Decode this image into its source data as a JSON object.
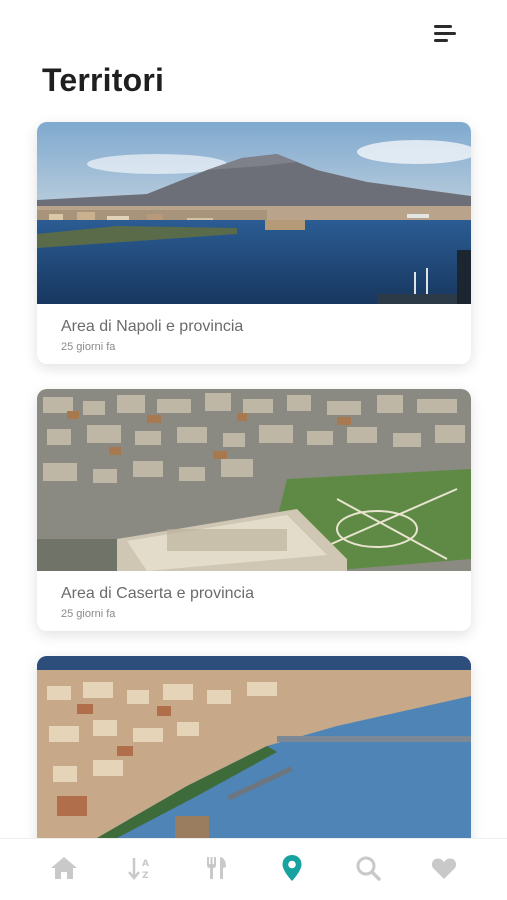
{
  "header": {
    "menu_icon": "menu-icon",
    "title": "Territori"
  },
  "cards": [
    {
      "title": "Area di Napoli e provincia",
      "date": "25 giorni fa"
    },
    {
      "title": "Area di Caserta e provincia",
      "date": "25 giorni fa"
    },
    {
      "title": "",
      "date": ""
    }
  ],
  "tabbar": {
    "items": [
      {
        "icon": "home-icon",
        "active": false
      },
      {
        "icon": "sort-alpha-icon",
        "active": false
      },
      {
        "icon": "restaurant-icon",
        "active": false
      },
      {
        "icon": "map-pin-icon",
        "active": true
      },
      {
        "icon": "search-icon",
        "active": false
      },
      {
        "icon": "heart-icon",
        "active": false
      }
    ],
    "active_color": "#17a2a0",
    "inactive_color": "#c9c9c9"
  }
}
